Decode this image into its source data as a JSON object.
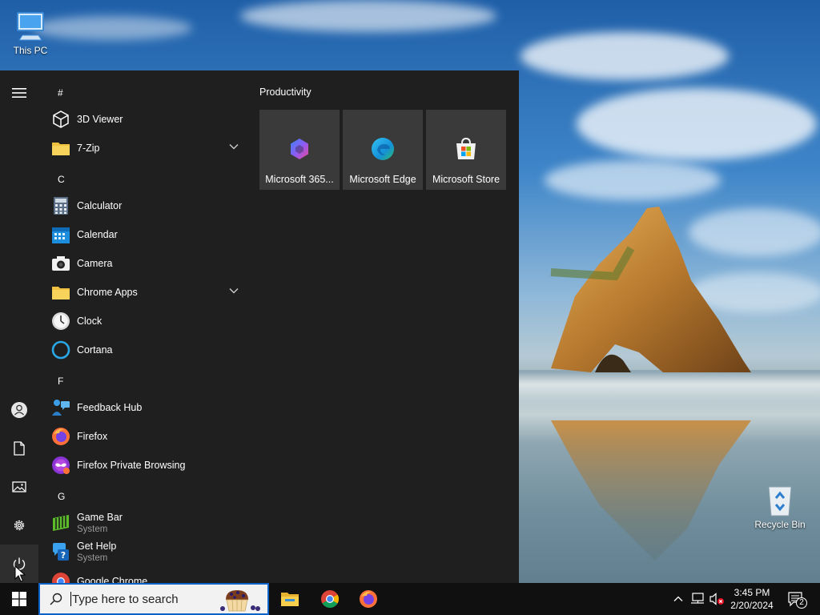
{
  "desktop": {
    "icons": [
      {
        "label": "This PC"
      },
      {
        "label": "Recycle Bin"
      }
    ]
  },
  "start_menu": {
    "rail": {
      "hamburger": "menu-icon",
      "items": [
        "user-icon",
        "documents-icon",
        "pictures-icon",
        "settings-icon",
        "power-icon"
      ]
    },
    "app_list": {
      "headers": [
        "#",
        "C",
        "F",
        "G"
      ],
      "apps": [
        {
          "name": "3D Viewer"
        },
        {
          "name": "7-Zip"
        },
        {
          "name": "Calculator"
        },
        {
          "name": "Calendar"
        },
        {
          "name": "Camera"
        },
        {
          "name": "Chrome Apps"
        },
        {
          "name": "Clock"
        },
        {
          "name": "Cortana"
        },
        {
          "name": "Feedback Hub"
        },
        {
          "name": "Firefox"
        },
        {
          "name": "Firefox Private Browsing"
        },
        {
          "name": "Game Bar",
          "sub": "System"
        },
        {
          "name": "Get Help",
          "sub": "System"
        },
        {
          "name": "Google Chrome"
        }
      ]
    },
    "tiles": {
      "group_title": "Productivity",
      "items": [
        {
          "label": "Microsoft 365..."
        },
        {
          "label": "Microsoft Edge"
        },
        {
          "label": "Microsoft Store"
        }
      ]
    }
  },
  "taskbar": {
    "search_placeholder": "Type here to search",
    "pinned": [
      "file-explorer-icon",
      "chrome-icon",
      "firefox-icon"
    ],
    "clock": {
      "time": "3:45 PM",
      "date": "2/20/2024"
    },
    "notifications_count": "2"
  },
  "colors": {
    "start_bg": "#1f1f1f",
    "tile_bg": "#3a3a3a",
    "taskbar_bg": "#101010",
    "search_border": "#0a64c8"
  }
}
